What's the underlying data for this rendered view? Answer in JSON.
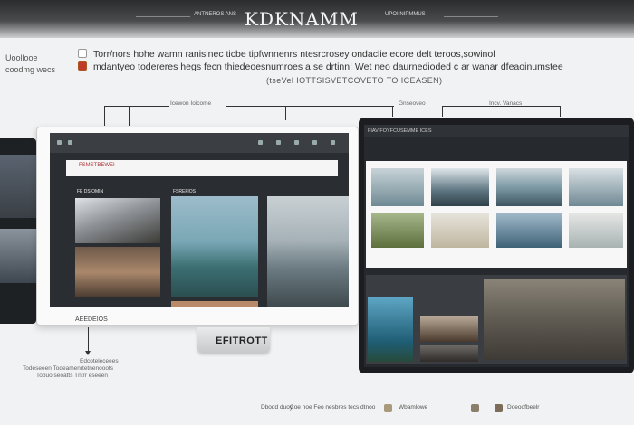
{
  "banner": {
    "brand": "KDKNAMM",
    "subtitle_left": "ANTNEROS ANS",
    "subtitle_right": "UPOI NIPMMUS"
  },
  "side_left": {
    "line1": "Uoollooe",
    "line2": "coodmg  wecs"
  },
  "header": {
    "line1": "Torr/nors hohe wamn    ranisinec ticbe tipfwnnenrs ntesrcrosey ondaclie ecore delt teroos,sowinol",
    "line2": "mdantyeo todereres hegs  fecn thiedeoesnumroes a se drtinn! Wet neo daurnedioded c ar wanar dfeaoinumstee",
    "line3": "(tseVel IOTTSISVETCOVETO TO ICEASEN)"
  },
  "callouts": {
    "c1": "Icewon  Ioicome",
    "c2": "Gnseoveo",
    "c3": "Incv. Vanacs"
  },
  "monitor": {
    "tab": "FSMSTBEWEI",
    "caption_top_left": "FE DSIOMIN",
    "caption_mid": "FSREFIOS",
    "caption_bottom": "AEEDEIOS",
    "stand_label": "EFITROTT"
  },
  "under_monitor": {
    "line1": "Edcoteleceees",
    "line2": "Todeseeen  Todeamenrtetnenooots",
    "line3": "Tobuo seoatts  Tntrr eseeen"
  },
  "tablet": {
    "menu": "FIAV  FOYFCUSEMME  ICES"
  },
  "footer": {
    "a": "Dbodd duoy",
    "b": "Coe noe  Feo nesbres tecs dtnoo",
    "c": "Wbamlowe",
    "d": "Doeoofbeelr"
  },
  "colors": {
    "accent_red": "#c0392b",
    "dark_ui": "#2a2d31"
  }
}
